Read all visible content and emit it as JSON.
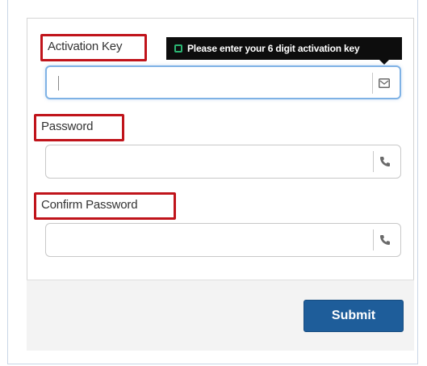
{
  "form": {
    "activation_key": {
      "label": "Activation Key",
      "value": "",
      "placeholder": "",
      "icon": "envelope-icon",
      "tooltip": "Please enter your 6 digit activation key"
    },
    "password": {
      "label": "Password",
      "value": "",
      "placeholder": "",
      "icon": "phone-icon"
    },
    "confirm_password": {
      "label": "Confirm Password",
      "value": "",
      "placeholder": "",
      "icon": "phone-icon"
    },
    "submit_label": "Submit"
  },
  "colors": {
    "highlight_border": "#c0141b",
    "focus_border": "#7fb2e5",
    "button_bg": "#1e5d9a",
    "tooltip_bg": "#0d0d0d",
    "tooltip_icon": "#2bb673"
  }
}
